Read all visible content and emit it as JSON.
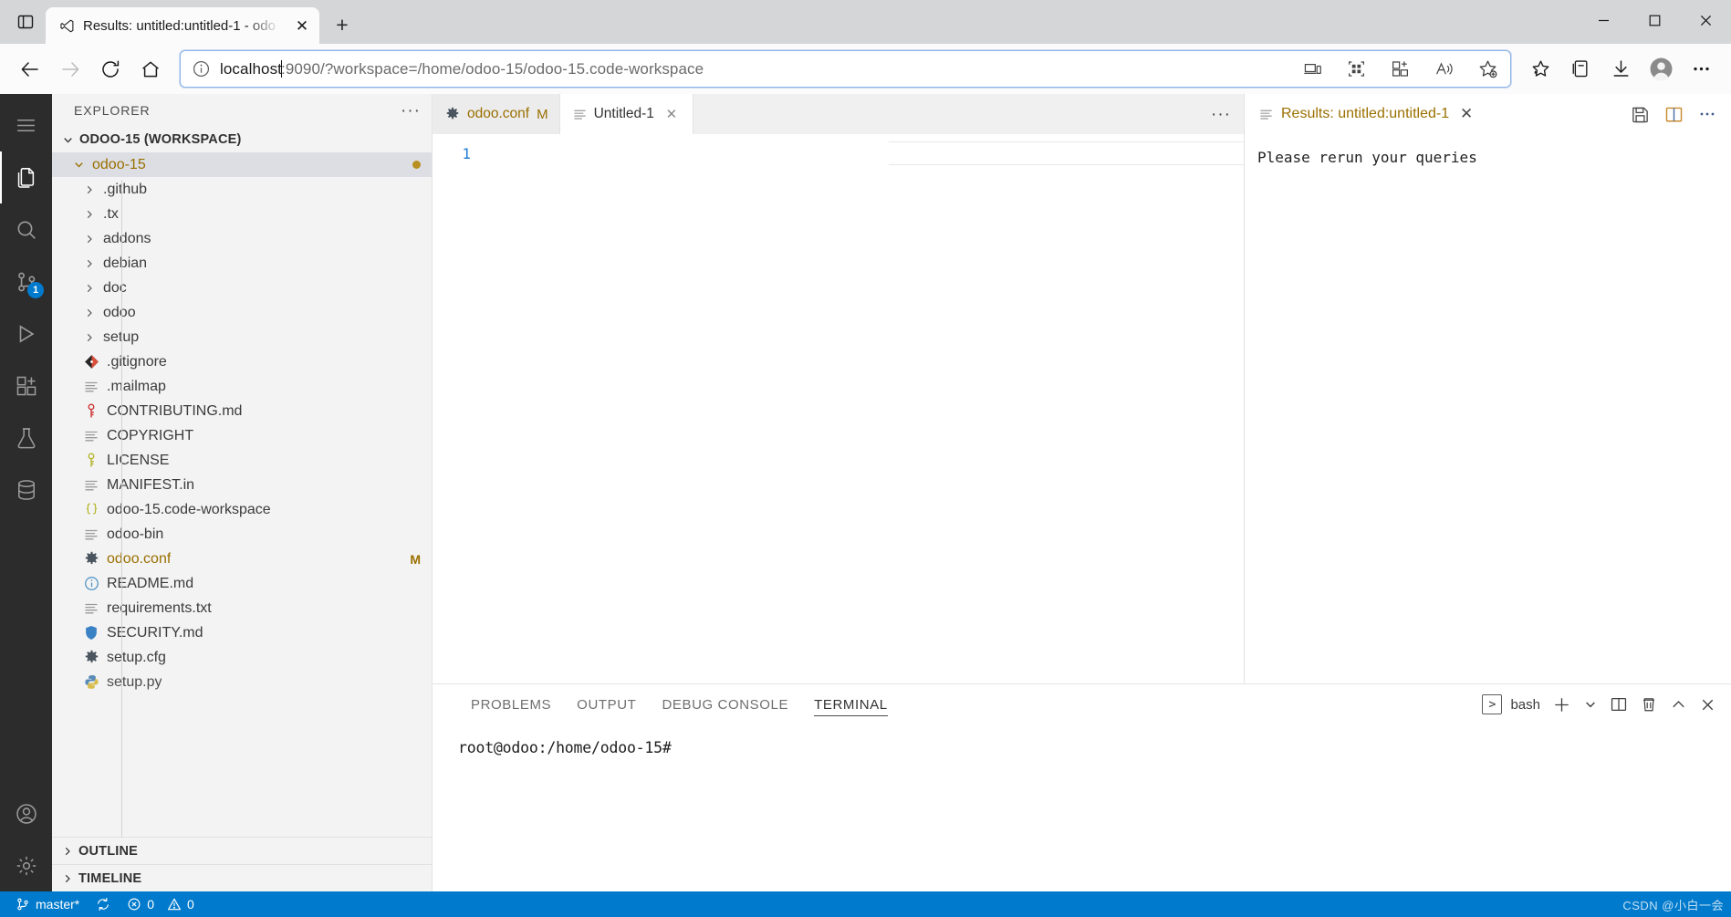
{
  "browser": {
    "tab": {
      "title": "Results: untitled:untitled-1 - odo",
      "favicon": "vscode-icon",
      "close_label": "✕"
    },
    "new_tab_label": "+",
    "window_controls": {
      "minimize": "─",
      "maximize": "□",
      "close": "✕"
    },
    "nav": {
      "back": "back-arrow",
      "forward": "forward-arrow",
      "reload": "reload-arrow",
      "home": "home-house"
    },
    "address": {
      "host": "localhost",
      "rest": ":9090/?workspace=/home/odoo-15/odoo-15.code-workspace",
      "full": "localhost:9090/?workspace=/home/odoo-15/odoo-15.code-workspace",
      "info_icon": "info-circle-icon"
    },
    "omni_icons": [
      "cast-device-icon",
      "split-screen-icon",
      "add-app-icon",
      "read-aloud-icon",
      "add-favorite-icon"
    ],
    "toolbar_icons": [
      "favorites-star-icon",
      "collections-icon",
      "downloads-icon",
      "profile-icon",
      "settings-more-icon"
    ]
  },
  "activitybar": {
    "items": [
      {
        "name": "menu",
        "icon": "hamburger-icon"
      },
      {
        "name": "explorer",
        "icon": "files-icon",
        "active": true
      },
      {
        "name": "search",
        "icon": "search-icon"
      },
      {
        "name": "source-control",
        "icon": "source-control-icon",
        "badge": "1"
      },
      {
        "name": "run-and-debug",
        "icon": "run-debug-icon"
      },
      {
        "name": "extensions",
        "icon": "extensions-icon"
      },
      {
        "name": "testing",
        "icon": "beaker-icon"
      },
      {
        "name": "database",
        "icon": "database-icon"
      },
      {
        "name": "accounts",
        "icon": "account-icon"
      },
      {
        "name": "manage",
        "icon": "gear-icon"
      }
    ]
  },
  "sidebar": {
    "title": "EXPLORER",
    "more_label": "···",
    "workspace": {
      "label": "ODOO-15 (WORKSPACE)",
      "expanded": true
    },
    "root_folder": {
      "label": "odoo-15",
      "expanded": true,
      "selected": true,
      "dirty": true
    },
    "items": [
      {
        "label": ".github",
        "type": "folder",
        "expanded": false,
        "icon": "chevron-right-icon"
      },
      {
        "label": ".tx",
        "type": "folder",
        "expanded": false,
        "icon": "chevron-right-icon"
      },
      {
        "label": "addons",
        "type": "folder",
        "expanded": false,
        "icon": "chevron-right-icon"
      },
      {
        "label": "debian",
        "type": "folder",
        "expanded": false,
        "icon": "chevron-right-icon"
      },
      {
        "label": "doc",
        "type": "folder",
        "expanded": false,
        "icon": "chevron-right-icon"
      },
      {
        "label": "odoo",
        "type": "folder",
        "expanded": false,
        "icon": "chevron-right-icon"
      },
      {
        "label": "setup",
        "type": "folder",
        "expanded": false,
        "icon": "chevron-right-icon"
      },
      {
        "label": ".gitignore",
        "type": "file",
        "icon": "git-icon"
      },
      {
        "label": ".mailmap",
        "type": "file",
        "icon": "text-file-icon"
      },
      {
        "label": "CONTRIBUTING.md",
        "type": "file",
        "icon": "key-red-icon"
      },
      {
        "label": "COPYRIGHT",
        "type": "file",
        "icon": "text-file-icon"
      },
      {
        "label": "LICENSE",
        "type": "file",
        "icon": "key-yellow-icon"
      },
      {
        "label": "MANIFEST.in",
        "type": "file",
        "icon": "text-file-icon"
      },
      {
        "label": "odoo-15.code-workspace",
        "type": "file",
        "icon": "braces-icon"
      },
      {
        "label": "odoo-bin",
        "type": "file",
        "icon": "text-file-icon"
      },
      {
        "label": "odoo.conf",
        "type": "file",
        "icon": "gear-file-icon",
        "status": "M",
        "modified": true
      },
      {
        "label": "README.md",
        "type": "file",
        "icon": "info-blue-icon"
      },
      {
        "label": "requirements.txt",
        "type": "file",
        "icon": "text-file-icon"
      },
      {
        "label": "SECURITY.md",
        "type": "file",
        "icon": "shield-blue-icon"
      },
      {
        "label": "setup.cfg",
        "type": "file",
        "icon": "gear-file-icon"
      },
      {
        "label": "setup.py",
        "type": "file",
        "icon": "python-icon"
      }
    ],
    "outline": {
      "label": "OUTLINE",
      "expanded": false
    },
    "timeline": {
      "label": "TIMELINE",
      "expanded": false
    }
  },
  "editor": {
    "tabs": [
      {
        "label": "odoo.conf",
        "status": "M",
        "icon": "gear-file-icon",
        "active": false,
        "modified": true
      },
      {
        "label": "Untitled-1",
        "status": "",
        "icon": "text-file-icon",
        "active": true,
        "close": "✕"
      }
    ],
    "more_label": "···",
    "content": {
      "line_numbers": [
        "1"
      ],
      "lines": [
        ""
      ]
    }
  },
  "results": {
    "title": "Results: untitled:untitled-1",
    "icon": "text-file-icon",
    "close": "✕",
    "message": "Please rerun your queries",
    "actions": [
      "save-icon",
      "split-editor-icon",
      "more-icon"
    ]
  },
  "panel": {
    "tabs": [
      {
        "label": "PROBLEMS",
        "active": false
      },
      {
        "label": "OUTPUT",
        "active": false
      },
      {
        "label": "DEBUG CONSOLE",
        "active": false
      },
      {
        "label": "TERMINAL",
        "active": true
      }
    ],
    "terminal_name": "bash",
    "terminal_chip_glyph": ">",
    "actions": [
      "new-terminal-icon",
      "terminal-dropdown-icon",
      "split-terminal-icon",
      "kill-terminal-icon",
      "maximize-panel-icon",
      "close-panel-icon"
    ],
    "terminal_line": "root@odoo:/home/odoo-15#"
  },
  "statusbar": {
    "branch": "master*",
    "branch_icon": "source-control-icon",
    "sync_icon": "sync-icon",
    "errors": "0",
    "warnings": "0",
    "error_icon": "error-circle-icon",
    "warning_icon": "warning-triangle-icon",
    "watermark": "CSDN @小白一会",
    "accent": "#007acc"
  }
}
